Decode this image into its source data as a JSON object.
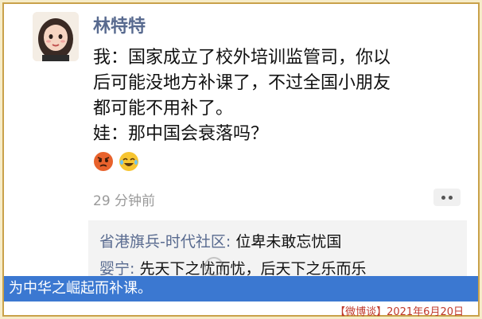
{
  "post": {
    "username": "林特特",
    "lines": [
      "我：国家成立了校外培训监管司，你以",
      "后可能没地方补课了，不过全国小朋友",
      "都可能不用补了。",
      "娃：那中国会衰落吗？"
    ],
    "emojis": [
      "angry-face-emoji",
      "crying-laughing-emoji"
    ],
    "timestamp": "29 分钟前"
  },
  "comments": [
    {
      "author": "省港旗兵-时代社区:",
      "text": "位卑未敢忘忧国"
    },
    {
      "author": "婴宁:",
      "text": "先天下之忧而忧，后天下之乐而乐"
    }
  ],
  "caption": "为中华之崛起而补课。",
  "source": "【微博谈】2021年6月20日",
  "colors": {
    "accent_blue": "#3b78d1",
    "name_color": "#586a8f",
    "frame_gold": "#c9a24a",
    "source_red": "#c0392b"
  }
}
